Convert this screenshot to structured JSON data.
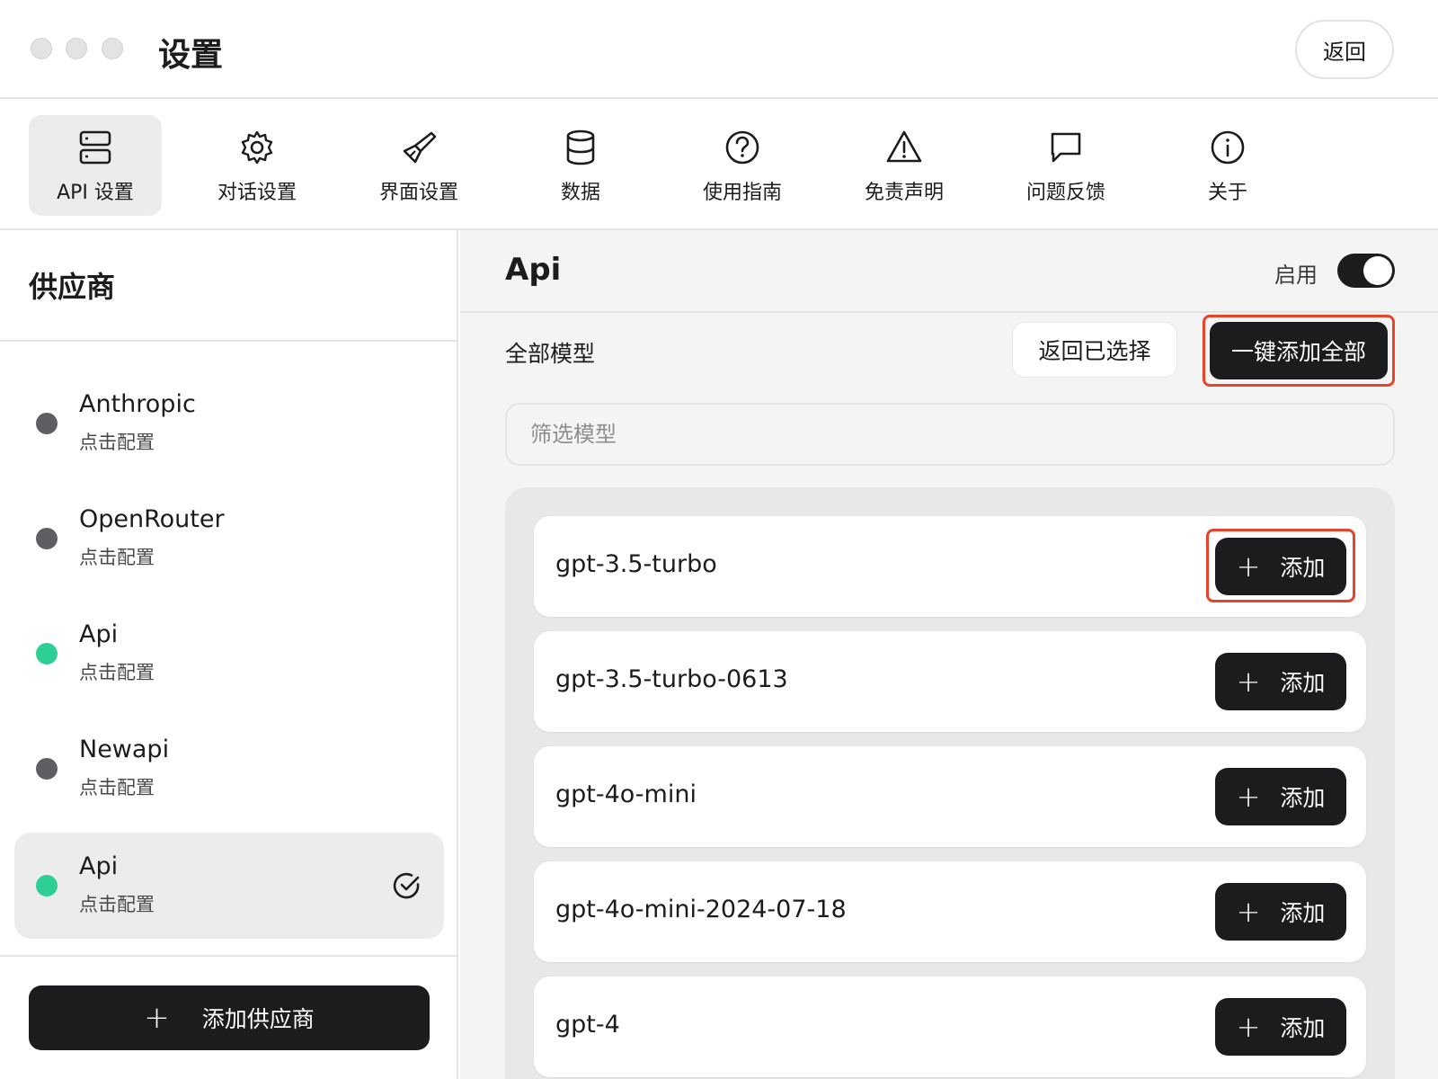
{
  "window": {
    "title": "设置",
    "back_label": "返回"
  },
  "tabs": [
    {
      "label": "API 设置",
      "icon": "server-icon",
      "active": true
    },
    {
      "label": "对话设置",
      "icon": "gear-icon",
      "active": false
    },
    {
      "label": "界面设置",
      "icon": "brush-icon",
      "active": false
    },
    {
      "label": "数据",
      "icon": "database-icon",
      "active": false
    },
    {
      "label": "使用指南",
      "icon": "help-circle-icon",
      "active": false
    },
    {
      "label": "免责声明",
      "icon": "warning-icon",
      "active": false
    },
    {
      "label": "问题反馈",
      "icon": "chat-bubble-icon",
      "active": false
    },
    {
      "label": "关于",
      "icon": "info-icon",
      "active": false
    }
  ],
  "sidebar": {
    "title": "供应商",
    "providers": [
      {
        "name": "Anthropic",
        "sub": "点击配置",
        "enabled": false,
        "selected": false
      },
      {
        "name": "OpenRouter",
        "sub": "点击配置",
        "enabled": false,
        "selected": false
      },
      {
        "name": "Api",
        "sub": "点击配置",
        "enabled": true,
        "selected": false
      },
      {
        "name": "Newapi",
        "sub": "点击配置",
        "enabled": false,
        "selected": false
      },
      {
        "name": "Api",
        "sub": "点击配置",
        "enabled": true,
        "selected": true
      }
    ],
    "add_provider_label": "添加供应商"
  },
  "main": {
    "title": "Api",
    "enable_label": "启用",
    "enabled": true,
    "all_models_label": "全部模型",
    "back_selected_label": "返回已选择",
    "add_all_label": "一键添加全部",
    "filter_placeholder": "筛选模型",
    "add_label": "添加",
    "models": [
      {
        "name": "gpt-3.5-turbo",
        "highlighted": true
      },
      {
        "name": "gpt-3.5-turbo-0613",
        "highlighted": false
      },
      {
        "name": "gpt-4o-mini",
        "highlighted": false
      },
      {
        "name": "gpt-4o-mini-2024-07-18",
        "highlighted": false
      },
      {
        "name": "gpt-4",
        "highlighted": false
      }
    ]
  },
  "colors": {
    "accent_dark": "#1c1c1e",
    "status_on": "#2ecf95",
    "status_off": "#5f5f63",
    "highlight_outline": "#e8442a"
  }
}
